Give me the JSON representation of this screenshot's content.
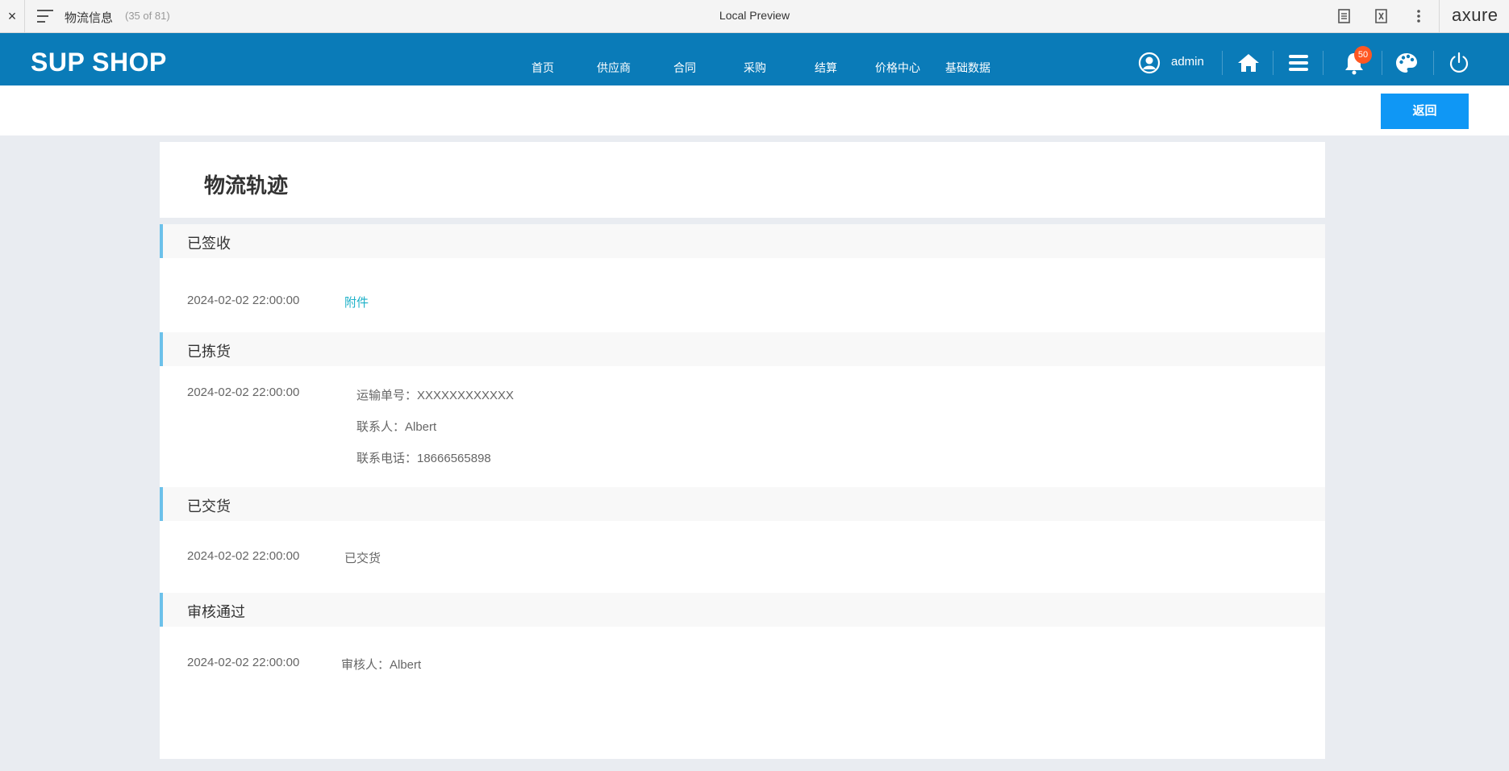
{
  "preview_bar": {
    "close": "×",
    "page_name": "物流信息",
    "page_count": "(35 of 81)",
    "title": "Local Preview",
    "logo": "axure"
  },
  "header": {
    "brand": "SUP SHOP",
    "nav": [
      "首页",
      "供应商",
      "合同",
      "采购",
      "结算",
      "价格中心",
      "基础数据"
    ],
    "user": "admin",
    "notification_count": "50",
    "colors": {
      "bar": "#0a7bb8",
      "badge": "#ff5722"
    }
  },
  "sub_bar": {
    "back_label": "返回"
  },
  "panel": {
    "title": "物流轨迹",
    "sections": [
      {
        "status": "已签收",
        "time": "2024-02-02 22:00:00",
        "link": "附件"
      },
      {
        "status": "已拣货",
        "time": "2024-02-02 22:00:00",
        "details": [
          "运输单号：XXXXXXXXXXXX",
          "联系人：Albert",
          "联系电话：18666565898"
        ]
      },
      {
        "status": "已交货",
        "time": "2024-02-02 22:00:00",
        "note": "已交货"
      },
      {
        "status": "审核通过",
        "time": "2024-02-02 22:00:00",
        "note": "审核人：Albert"
      }
    ],
    "accent_color": "#6cc1ea",
    "button_color": "#0f97f5"
  }
}
